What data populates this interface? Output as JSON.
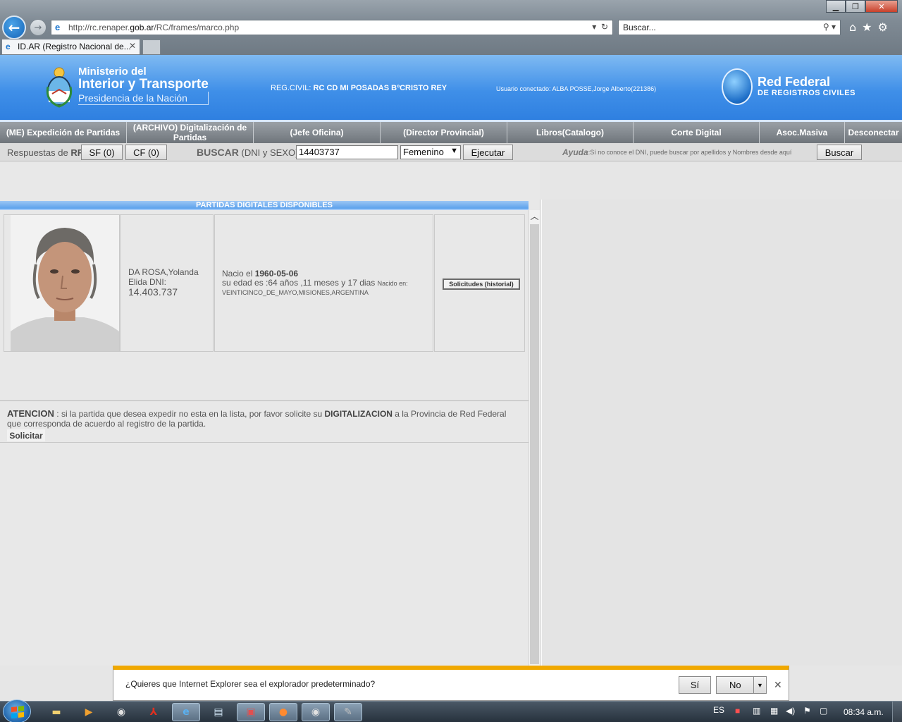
{
  "browser": {
    "url_prefix": "http://rc.renaper.",
    "url_domain": "gob.ar",
    "url_path": "/RC/frames/marco.php",
    "search_placeholder": "Buscar...",
    "tab_title": "ID.AR (Registro Nacional de..."
  },
  "header": {
    "ministerio_line1": "Ministerio del",
    "ministerio_line2": "Interior y Transporte",
    "ministerio_line3": "Presidencia de la Nación",
    "regcivil_label": "REG.CIVIL:",
    "regcivil_value": "RC CD MI POSADAS BºCRISTO REY",
    "usuario": "Usuario conectado: ALBA POSSE,Jorge Alberto(221386)",
    "red_federal_1": "Red Federal",
    "red_federal_2": "DE REGISTROS CIVILES"
  },
  "menu": [
    {
      "label": "(ME) Expedición de Partidas"
    },
    {
      "label": "(ARCHIVO) Digitalización de Partidas"
    },
    {
      "label": "(Jefe Oficina)"
    },
    {
      "label": "(Director Provincial)"
    },
    {
      "label": "Libros(Catalogo)"
    },
    {
      "label": "Corte Digital"
    },
    {
      "label": "Asoc.Masiva"
    },
    {
      "label": "Desconectar"
    }
  ],
  "search_row": {
    "respuestas_label": "Respuestas de",
    "rf": "RF",
    "sf_button": "SF (0)",
    "cf_button": "CF (0)",
    "buscar_label": "BUSCAR",
    "buscar_hint": "(DNI y SEXO)",
    "dni_value": "14403737",
    "sexo_selected": "Femenino",
    "ejecutar_button": "Ejecutar",
    "ayuda_label": "Ayuda",
    "ayuda_text": ":Sí no conoce el DNI, puede buscar por apellidos y Nombres desde aquí",
    "buscar_button": "Buscar"
  },
  "results": {
    "section_title": "PARTIDAS DIGITALES DISPONIBLES",
    "person": {
      "name_line1": "DA ROSA,Yolanda",
      "name_line2": "Elida DNI:",
      "dni": "14.403.737",
      "nacio_label": "Nacio el",
      "nacio_date": "1960-05-06",
      "edad_text": "su edad es :64 años ,11 meses y 17 dias",
      "nacido_en_label": "Nacido en:",
      "nacido_en": "VEINTICINCO_DE_MAYO,MISIONES,ARGENTINA",
      "historial_button": "Solicitudes (historial)"
    }
  },
  "atencion": {
    "heading": "ATENCION",
    "text1": ": si la partida que desea expedir no esta en la lista, por favor solicite su",
    "bold": "DIGITALIZACION",
    "text2": "a la Provincia de Red Federal que corresponda de acuerdo al registro de la partida.",
    "solicitar_button": "Solicitar"
  },
  "notification": {
    "message": "¿Quieres que Internet Explorer sea el explorador predeterminado?",
    "yes": "Sí",
    "no": "No"
  },
  "taskbar": {
    "language": "ES",
    "time": "08:34 a.m."
  }
}
